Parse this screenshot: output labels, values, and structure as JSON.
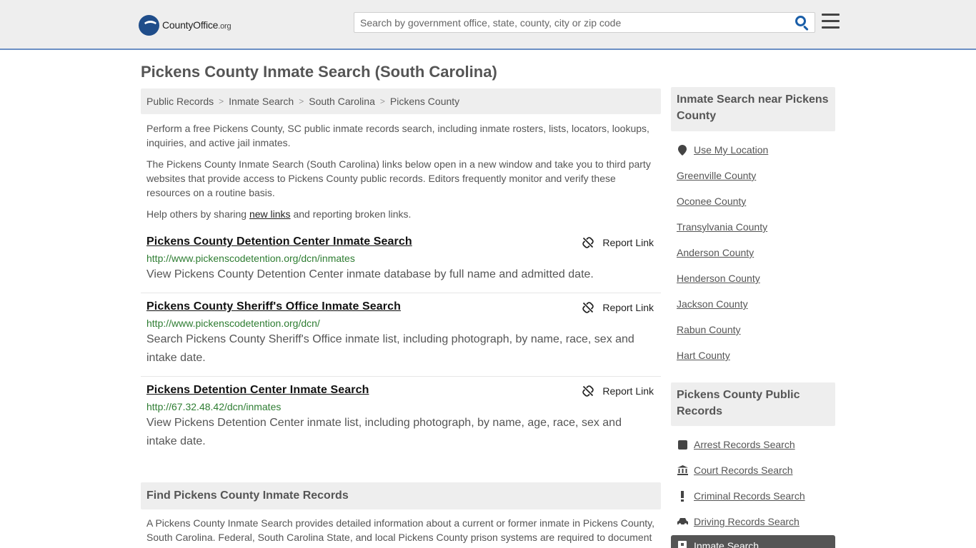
{
  "header": {
    "logo_text_main": "CountyOffice",
    "logo_text_tld": ".org",
    "search_placeholder": "Search by government office, state, county, city or zip code",
    "brand_color": "#1f4d8a",
    "accent_color": "#1a5ea8"
  },
  "page": {
    "title": "Pickens County Inmate Search (South Carolina)"
  },
  "breadcrumb": [
    "Public Records",
    "Inmate Search",
    "South Carolina",
    "Pickens County"
  ],
  "intro": {
    "p1": "Perform a free Pickens County, SC public inmate records search, including inmate rosters, lists, locators, lookups, inquiries, and active jail inmates.",
    "p2": "The Pickens County Inmate Search (South Carolina) links below open in a new window and take you to third party websites that provide access to Pickens County public records. Editors frequently monitor and verify these resources on a routine basis.",
    "p3_before": "Help others by sharing ",
    "p3_link": "new links",
    "p3_after": " and reporting broken links."
  },
  "links": [
    {
      "title": "Pickens County Detention Center Inmate Search",
      "url": "http://www.pickenscodetention.org/dcn/inmates",
      "desc": "View Pickens County Detention Center inmate database by full name and admitted date.",
      "report_label": "Report Link"
    },
    {
      "title": "Pickens County Sheriff's Office Inmate Search",
      "url": "http://www.pickenscodetention.org/dcn/",
      "desc": "Search Pickens County Sheriff's Office inmate list, including photograph, by name, race, sex and intake date.",
      "report_label": "Report Link"
    },
    {
      "title": "Pickens Detention Center Inmate Search",
      "url": "http://67.32.48.42/dcn/inmates",
      "desc": "View Pickens Detention Center inmate list, including photograph, by name, age, race, sex and intake date.",
      "report_label": "Report Link"
    }
  ],
  "find_section": {
    "title": "Find Pickens County Inmate Records",
    "body": "A Pickens County Inmate Search provides detailed information about a current or former inmate in Pickens County, South Carolina. Federal, South Carolina State, and local Pickens County prison systems are required to document"
  },
  "sidebar": {
    "near_title": "Inmate Search near Pickens County",
    "near_items": [
      {
        "label": "Use My Location",
        "icon": "location-pin-icon"
      },
      {
        "label": "Greenville County"
      },
      {
        "label": "Oconee County"
      },
      {
        "label": "Transylvania County"
      },
      {
        "label": "Anderson County"
      },
      {
        "label": "Henderson County"
      },
      {
        "label": "Jackson County"
      },
      {
        "label": "Rabun County"
      },
      {
        "label": "Hart County"
      }
    ],
    "records_title": "Pickens County Public Records",
    "records_items": [
      {
        "label": "Arrest Records Search",
        "icon": "arrest-icon"
      },
      {
        "label": "Court Records Search",
        "icon": "courthouse-icon"
      },
      {
        "label": "Criminal Records Search",
        "icon": "exclamation-icon"
      },
      {
        "label": "Driving Records Search",
        "icon": "car-icon"
      }
    ],
    "active_item": {
      "label": "Inmate Search",
      "icon": "inmate-icon"
    }
  }
}
